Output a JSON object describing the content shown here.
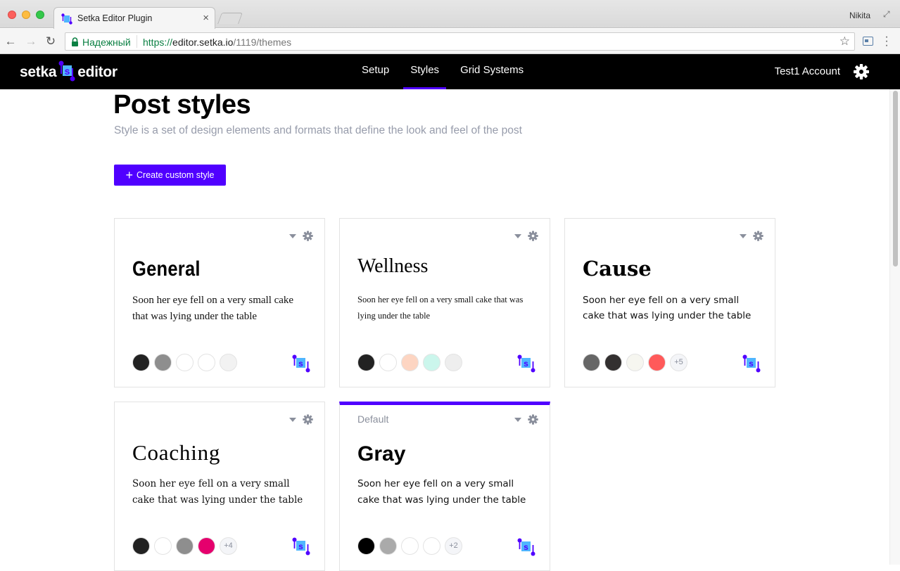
{
  "browser": {
    "tab_title": "Setka Editor Plugin",
    "tab_close": "×",
    "profile_name": "Nikita",
    "secure_label": "Надежный",
    "url_scheme": "https://",
    "url_host": "editor.setka.io",
    "url_path": "/1119/themes"
  },
  "header": {
    "logo_left": "setka",
    "logo_right": "editor",
    "nav": [
      {
        "label": "Setup",
        "active": false
      },
      {
        "label": "Styles",
        "active": true
      },
      {
        "label": "Grid Systems",
        "active": false
      }
    ],
    "account": "Test1 Account"
  },
  "page": {
    "title": "Post styles",
    "subtitle": "Style is a set of design elements and formats that define the look and feel of the post",
    "create_button": "Create custom style"
  },
  "cards": [
    {
      "title": "General",
      "text": "Soon her eye fell on a very small cake that was lying under the table",
      "default_label": "",
      "swatches": [
        "#222222",
        "#8e8e8e",
        "#ffffff",
        "#ffffff",
        "#f2f2f2"
      ],
      "more": ""
    },
    {
      "title": "Wellness",
      "text": "Soon her eye fell on a very small cake that was lying under the table",
      "default_label": "",
      "swatches": [
        "#222222",
        "#ffffff",
        "#fdd5c2",
        "#cbf6ec",
        "#eeeeee"
      ],
      "more": ""
    },
    {
      "title": "Cause",
      "text": "Soon her eye fell on a very small cake that was lying under the table",
      "default_label": "",
      "swatches": [
        "#666666",
        "#333030",
        "#f6f6f0",
        "#ff5a5a"
      ],
      "more": "+5"
    },
    {
      "title": "Coaching",
      "text": "Soon her eye fell on a very small cake that was lying under the table",
      "default_label": "",
      "swatches": [
        "#222222",
        "#ffffff",
        "#8e8e8e",
        "#e5006d"
      ],
      "more": "+4"
    },
    {
      "title": "Gray",
      "text": "Soon her eye fell on a very small cake that was lying under the table",
      "default_label": "Default",
      "swatches": [
        "#000000",
        "#aaaaaa",
        "#ffffff",
        "#ffffff"
      ],
      "more": "+2"
    }
  ],
  "colors": {
    "accent": "#5000ff",
    "header_bg": "#000000",
    "muted": "#979cab"
  }
}
